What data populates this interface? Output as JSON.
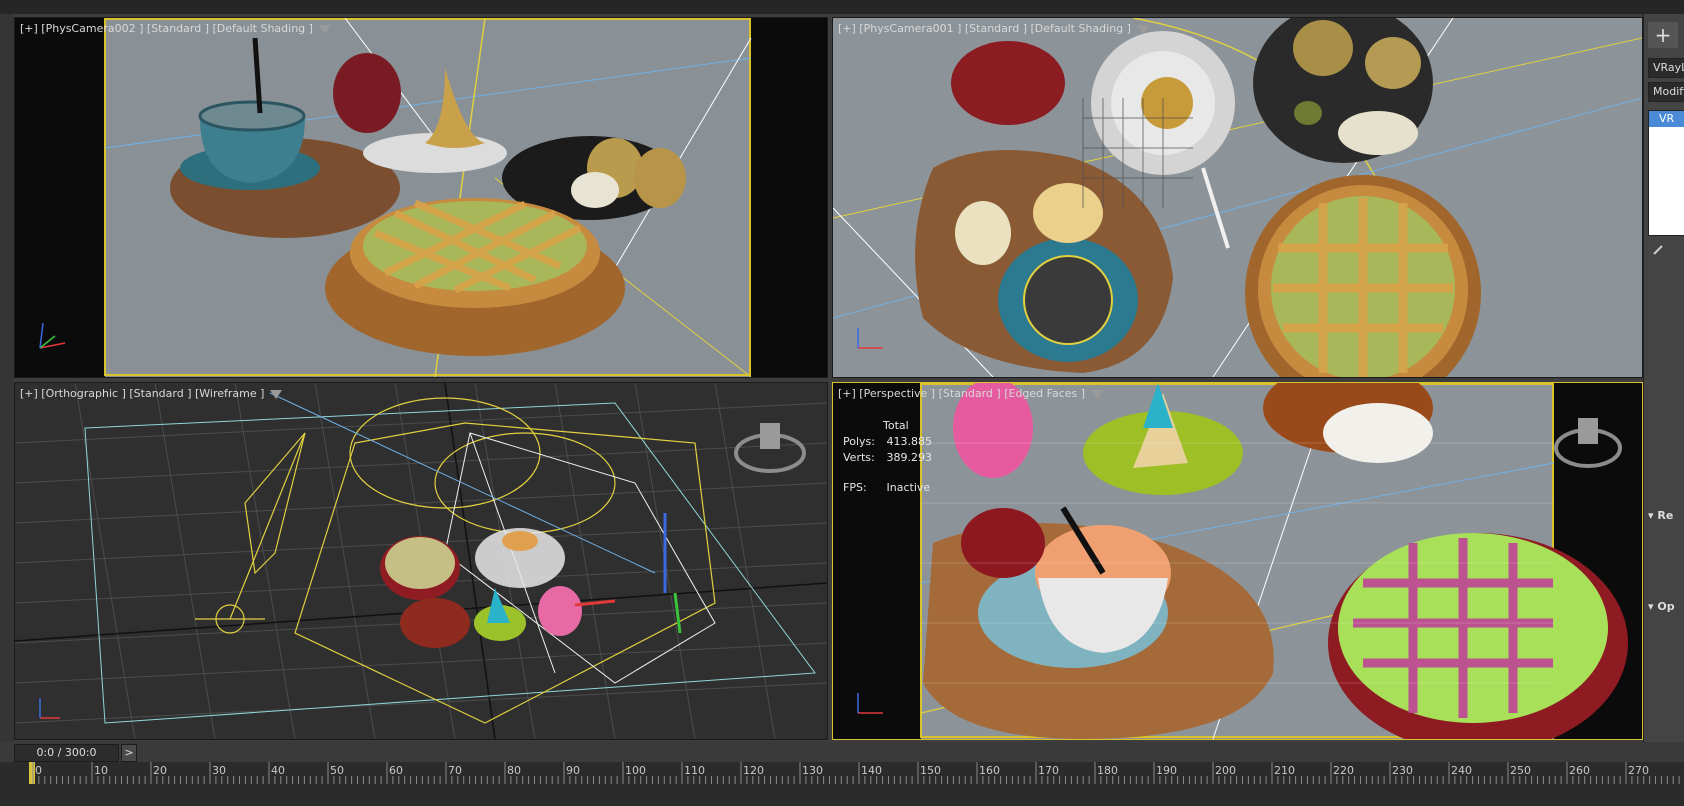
{
  "viewports": {
    "top_left": {
      "label": "[+] [PhysCamera002 ] [Standard ] [Default Shading ]"
    },
    "top_right": {
      "label": "[+] [PhysCamera001 ] [Standard ] [Default Shading ]"
    },
    "bottom_left": {
      "label": "[+] [Orthographic ] [Standard ] [Wireframe ]"
    },
    "bottom_right": {
      "label": "[+] [Perspective ] [Standard ] [Edged Faces ]",
      "stats": {
        "header": "Total",
        "polys_label": "Polys:",
        "polys_value": "413.885",
        "verts_label": "Verts:",
        "verts_value": "389.293",
        "fps_label": "FPS:",
        "fps_value": "Inactive"
      }
    }
  },
  "command_panel": {
    "create_icon": "plus-icon",
    "object_name": "VRayL",
    "modifier_list": "Modifi",
    "stack_item": "VR",
    "section_rendering": "Re",
    "section_options": "Op"
  },
  "time_slider": {
    "frame_display": "0:0 / 300:0",
    "next_label": ">"
  },
  "timeline": {
    "ticks": [
      "0",
      "10",
      "20",
      "30",
      "40",
      "50",
      "60",
      "70",
      "80",
      "90",
      "100",
      "110",
      "120",
      "130",
      "140",
      "150",
      "160",
      "170",
      "180",
      "190",
      "200",
      "210",
      "220",
      "230",
      "240",
      "250",
      "260",
      "270"
    ]
  },
  "colors": {
    "active_border": "#d9c22b",
    "selection": "#4b8ad6",
    "viewport_bg": "#2e2e2e"
  }
}
